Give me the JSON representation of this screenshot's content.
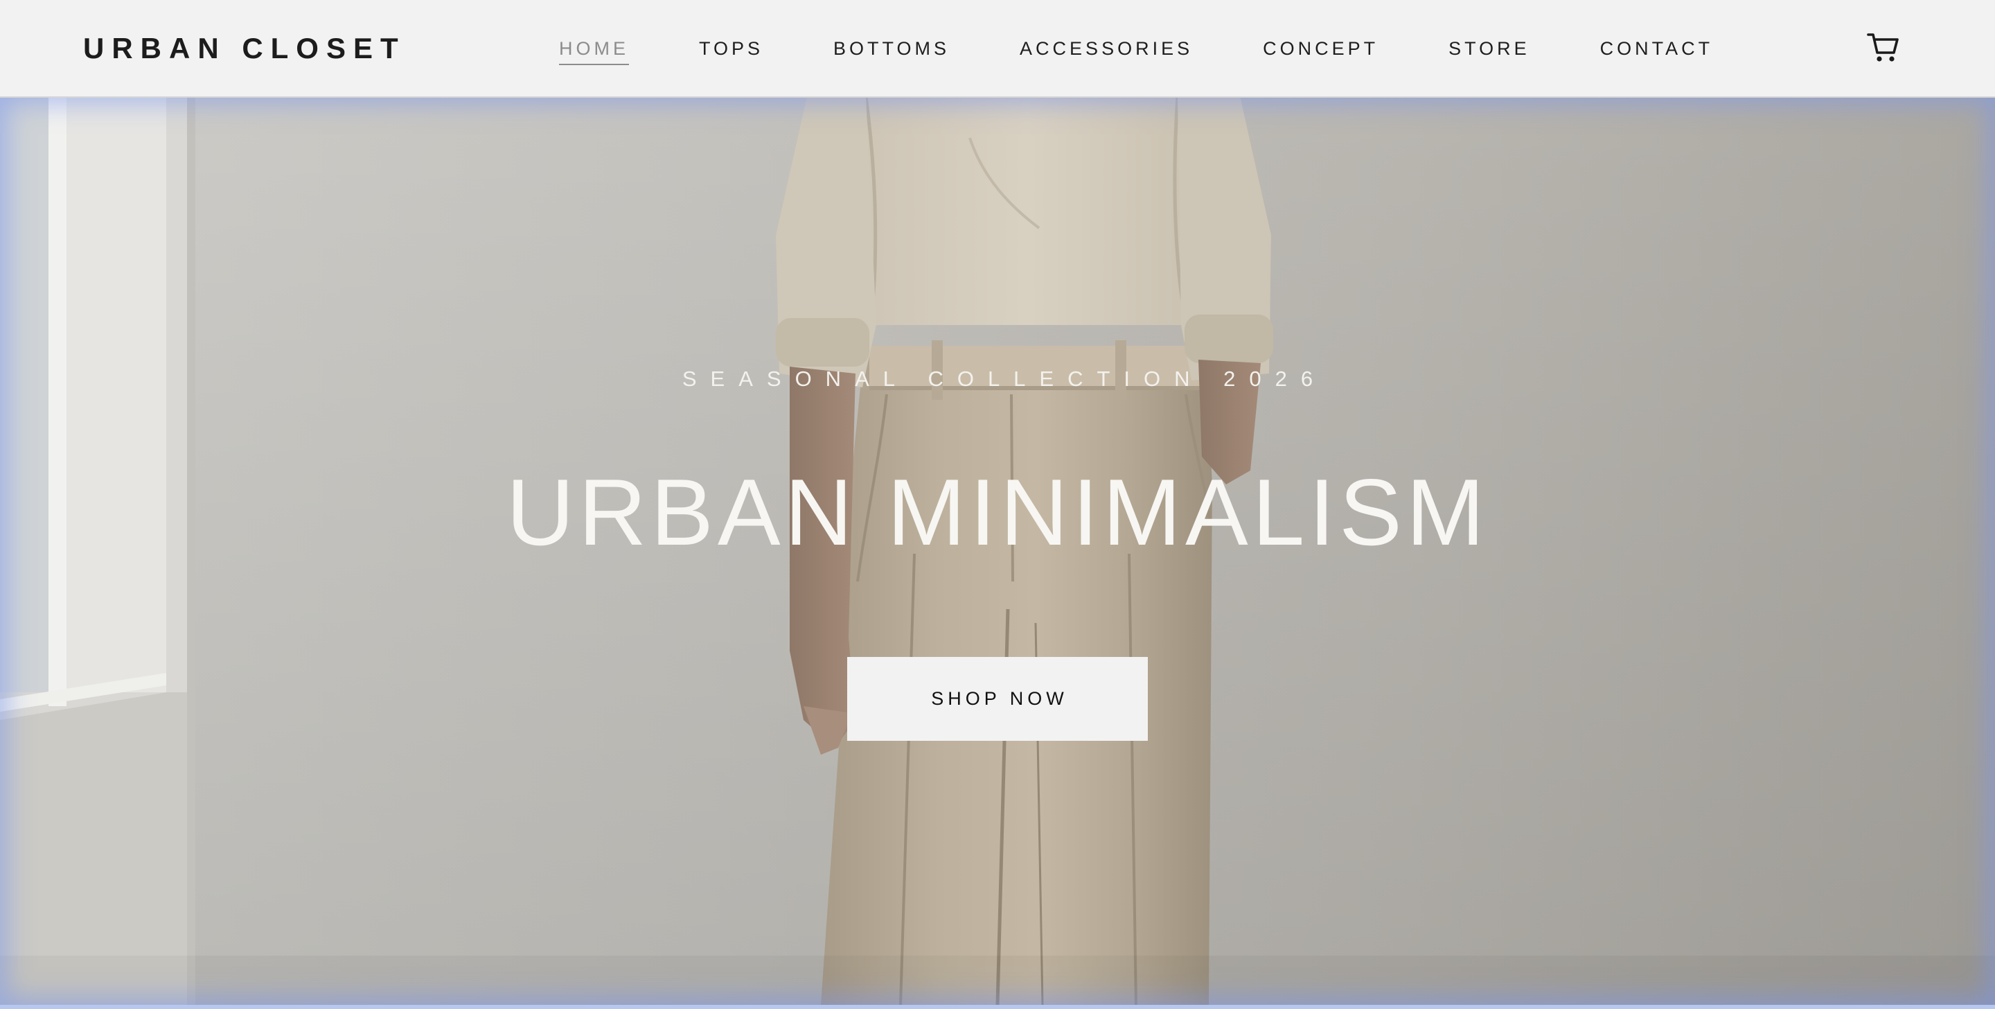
{
  "header": {
    "brand": "URBAN CLOSET",
    "nav": [
      {
        "label": "HOME",
        "active": true
      },
      {
        "label": "TOPS",
        "active": false
      },
      {
        "label": "BOTTOMS",
        "active": false
      },
      {
        "label": "ACCESSORIES",
        "active": false
      },
      {
        "label": "CONCEPT",
        "active": false
      },
      {
        "label": "STORE",
        "active": false
      },
      {
        "label": "CONTACT",
        "active": false
      }
    ],
    "cart_icon": "shopping-cart-icon"
  },
  "hero": {
    "eyebrow": "SEASONAL COLLECTION 2026",
    "title": "URBAN MINIMALISM",
    "cta_label": "SHOP NOW",
    "image_subject": "model-in-linen-outfit-photo"
  },
  "colors": {
    "header_bg": "#f2f2f2",
    "text_dark": "#1c1c1c",
    "nav_active": "#8c8c8c",
    "hero_text": "#f7f6f3",
    "button_bg": "#f2f2f2",
    "frame_glow": "#7896f0"
  }
}
